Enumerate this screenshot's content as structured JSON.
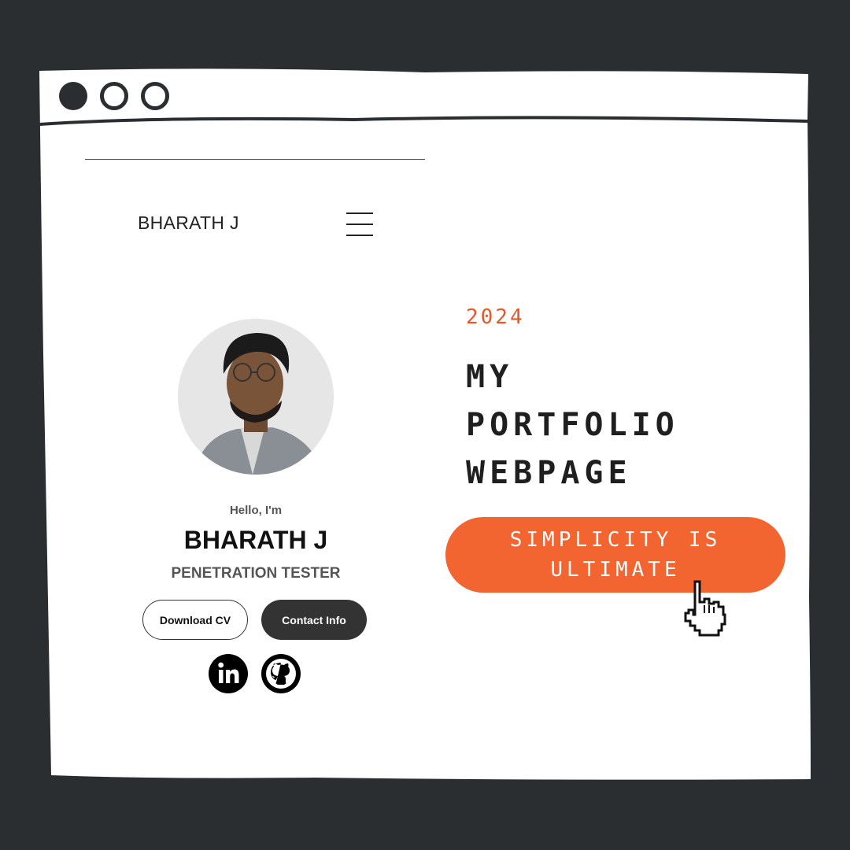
{
  "nav": {
    "brand": "BHARATH J"
  },
  "profile": {
    "greeting": "Hello, I'm",
    "name": "BHARATH J",
    "role": "PENETRATION TESTER",
    "buttons": {
      "download": "Download CV",
      "contact": "Contact Info"
    },
    "social": [
      "linkedin-icon",
      "github-icon"
    ]
  },
  "hero": {
    "year": "2024",
    "title_lines": [
      "MY",
      "PORTFOLIO",
      "WEBPAGE"
    ],
    "cta_lines": [
      "SIMPLICITY IS",
      "ULTIMATE"
    ]
  },
  "colors": {
    "background": "#2b2e31",
    "accent": "#f26430",
    "accent_text": "#e5572a",
    "button_dark": "#333333"
  }
}
